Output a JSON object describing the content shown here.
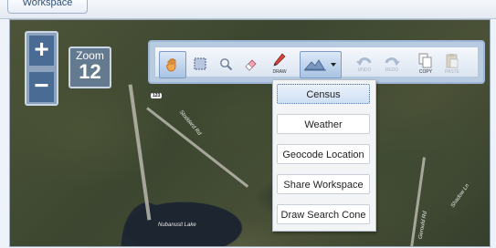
{
  "tab": {
    "label": "Workspace"
  },
  "map": {
    "road_shield": "123",
    "road_label": "Stoddard Rd",
    "lake_label": "Nubanusit Lake",
    "east_road_label": "Shadow Ln",
    "side_road_label": "Gerould Rd"
  },
  "zoom": {
    "plus": "+",
    "minus": "−",
    "label": "Zoom",
    "level": "12"
  },
  "toolbar": {
    "tools": [
      {
        "name": "pan",
        "icon": "hand-icon",
        "caption": ""
      },
      {
        "name": "select",
        "icon": "select-rect-icon",
        "caption": ""
      },
      {
        "name": "search",
        "icon": "magnifier-icon",
        "caption": ""
      },
      {
        "name": "erase",
        "icon": "eraser-icon",
        "caption": ""
      },
      {
        "name": "draw",
        "icon": "pencil-icon",
        "caption": "DRAW"
      },
      {
        "name": "analysis",
        "icon": "analysis-dropdown-icon",
        "caption": ""
      },
      {
        "name": "undo",
        "icon": "undo-icon",
        "caption": "UNDO"
      },
      {
        "name": "redo",
        "icon": "redo-icon",
        "caption": "REDO"
      },
      {
        "name": "copy",
        "icon": "copy-icon",
        "caption": "COPY"
      },
      {
        "name": "paste",
        "icon": "paste-icon",
        "caption": "PASTE"
      }
    ]
  },
  "menu": {
    "items": [
      "Census",
      "Weather",
      "Geocode Location",
      "Share Workspace",
      "Draw Search Cone"
    ]
  }
}
